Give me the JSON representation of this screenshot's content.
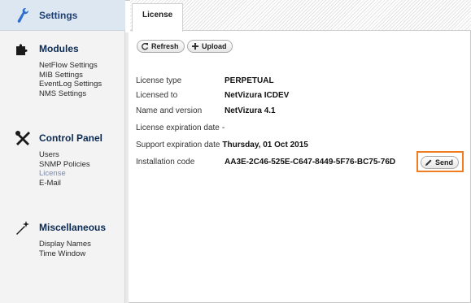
{
  "sidebar": {
    "settings_title": "Settings",
    "sections": [
      {
        "title": "Modules",
        "icon": "puzzle-icon",
        "items": [
          "NetFlow Settings",
          "MIB Settings",
          "EventLog Settings",
          "NMS Settings"
        ]
      },
      {
        "title": "Control Panel",
        "icon": "tools-icon",
        "items": [
          "Users",
          "SNMP Policies",
          "License",
          "E-Mail"
        ],
        "active": "License"
      },
      {
        "title": "Miscellaneous",
        "icon": "magic-wand-icon",
        "items": [
          "Display Names",
          "Time Window"
        ]
      }
    ]
  },
  "tab": {
    "label": "License"
  },
  "toolbar": {
    "refresh_label": "Refresh",
    "upload_label": "Upload"
  },
  "license": {
    "type_label": "License type",
    "type_value": "PERPETUAL",
    "licensed_to_label": "Licensed to",
    "licensed_to_value": "NetVizura ICDEV",
    "name_version_label": "Name and version",
    "name_version_value": "NetVizura 4.1",
    "expiration_label": "License expiration date",
    "expiration_value": "-",
    "support_label": "Support expiration date",
    "support_value": "Thursday, 01 Oct 2015",
    "install_code_label": "Installation code",
    "install_code_value": "AA3E-2C46-525E-C647-8449-5F76-BC75-76D",
    "send_label": "Send"
  },
  "colors": {
    "accent_outline": "#f07d22",
    "header_text": "#0a2a54",
    "sidebar_bg": "#f3f3f3"
  }
}
